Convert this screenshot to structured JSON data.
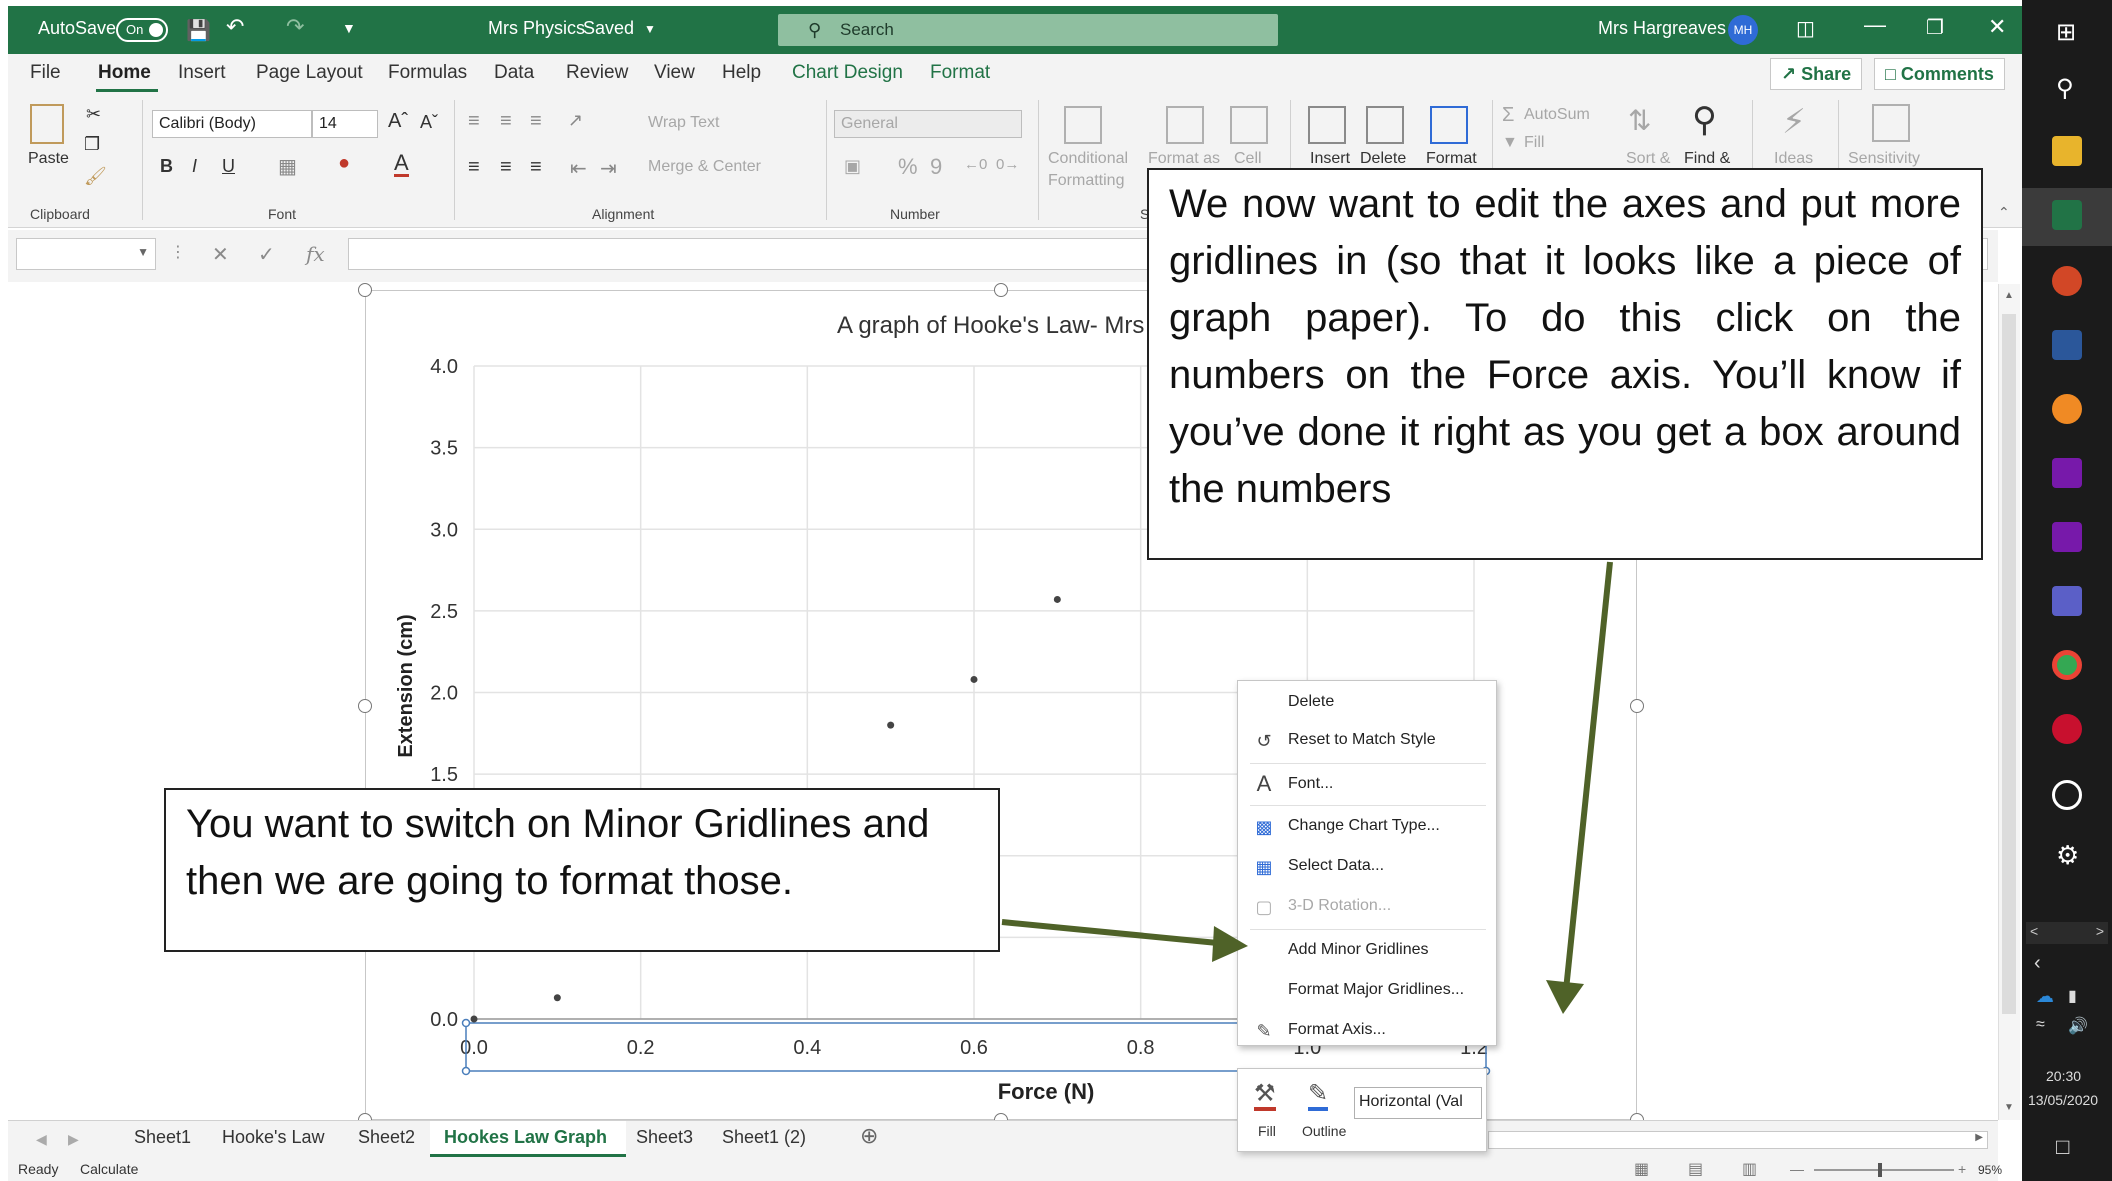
{
  "titlebar": {
    "autosave_label": "AutoSave",
    "autosave_state": "On",
    "document_title": "Mrs Physics",
    "save_status": "Saved",
    "search_placeholder": "Search",
    "user_name": "Mrs Hargreaves",
    "user_initials": "MH",
    "accent_color": "#217346"
  },
  "menu": {
    "tabs": [
      "File",
      "Home",
      "Insert",
      "Page Layout",
      "Formulas",
      "Data",
      "Review",
      "View",
      "Help",
      "Chart Design",
      "Format"
    ],
    "active_tab": "Home",
    "share_label": "Share",
    "comments_label": "Comments"
  },
  "ribbon": {
    "clipboard": {
      "paste": "Paste",
      "group": "Clipboard"
    },
    "font": {
      "name": "Calibri (Body)",
      "size": "14",
      "bold": "B",
      "italic": "I",
      "underline": "U",
      "group": "Font"
    },
    "alignment": {
      "wrap": "Wrap Text",
      "merge": "Merge & Center",
      "group": "Alignment"
    },
    "number": {
      "format": "General",
      "percent": "%",
      "comma": "9",
      "group": "Number"
    },
    "styles": {
      "conditional1": "Conditional",
      "conditional2": "Formatting",
      "format_as": "Format as",
      "cell": "Cell",
      "group": "S"
    },
    "cells": {
      "insert": "Insert",
      "delete": "Delete",
      "format": "Format"
    },
    "editing": {
      "autosum": "AutoSum",
      "fill": "Fill",
      "sort": "Sort &",
      "find": "Find &"
    },
    "ideas": "Ideas",
    "sensitivity": "Sensitivity"
  },
  "formula_bar": {
    "fx": "fx"
  },
  "chart_data": {
    "type": "scatter",
    "title": "A graph of Hooke's Law- Mrs P",
    "xlabel": "Force (N)",
    "ylabel": "Extension (cm)",
    "xlim": [
      0,
      1.2
    ],
    "ylim": [
      0,
      4.0
    ],
    "x_ticks": [
      "0.0",
      "0.2",
      "0.4",
      "0.6",
      "0.8",
      "1.0",
      "1.2"
    ],
    "y_ticks": [
      "0.0",
      "0.5",
      "1.0",
      "1.5",
      "2.0",
      "2.5",
      "3.0",
      "3.5",
      "4.0"
    ],
    "series": [
      {
        "x": [
          0.0,
          0.1,
          0.5,
          0.6,
          0.7
        ],
        "y": [
          0.0,
          0.13,
          1.8,
          2.08,
          2.57
        ]
      }
    ],
    "grid": "major",
    "legend": "none"
  },
  "callouts": {
    "top": "We now want to edit the axes and put more gridlines in (so that it looks like a piece of graph paper). To do this click on the numbers on the Force axis. You’ll know if you’ve done it right as you get a box around the numbers",
    "left": "You want to switch on Minor Gridlines and then we are going to format those.",
    "arrow_color": "#4f6228"
  },
  "context_menu": {
    "items": [
      {
        "label": "Delete",
        "enabled": true
      },
      {
        "label": "Reset to Match Style",
        "enabled": true
      },
      {
        "label": "Font...",
        "enabled": true
      },
      {
        "label": "Change Chart Type...",
        "enabled": true
      },
      {
        "label": "Select Data...",
        "enabled": true
      },
      {
        "label": "3-D Rotation...",
        "enabled": false
      },
      {
        "label": "Add Minor Gridlines",
        "enabled": true
      },
      {
        "label": "Format Major Gridlines...",
        "enabled": true
      },
      {
        "label": "Format Axis...",
        "enabled": true
      }
    ]
  },
  "mini_toolbar": {
    "fill": "Fill",
    "outline": "Outline",
    "element": "Horizontal (Val"
  },
  "sheets": {
    "tabs": [
      "Sheet1",
      "Hooke's Law",
      "Sheet2",
      "Hookes Law Graph",
      "Sheet3",
      "Sheet1 (2)"
    ],
    "active": "Hookes Law Graph"
  },
  "status": {
    "ready": "Ready",
    "calculate": "Calculate",
    "zoom": "95%"
  },
  "taskbar": {
    "time": "20:30",
    "date": "13/05/2020"
  }
}
